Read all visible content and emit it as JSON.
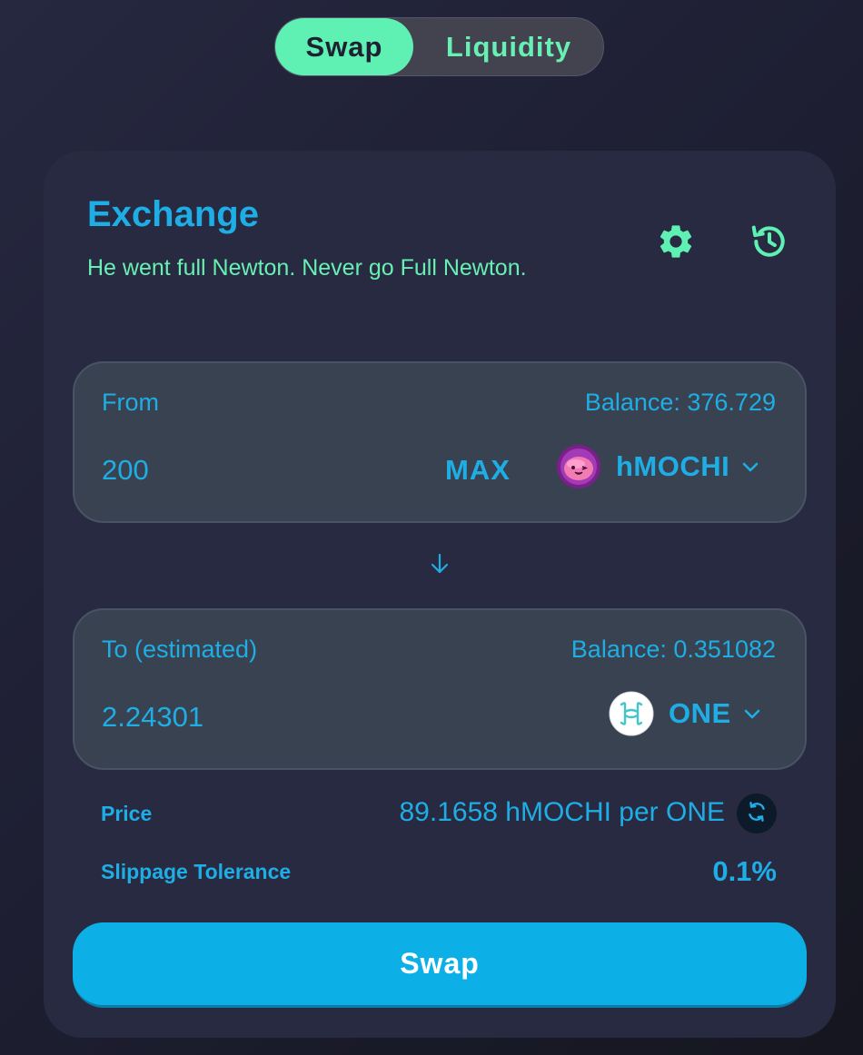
{
  "mode_toggle": {
    "swap_label": "Swap",
    "liquidity_label": "Liquidity",
    "active": "Swap"
  },
  "header": {
    "title": "Exchange",
    "subtitle": "He went full Newton. Never go Full Newton.",
    "settings_icon": "gear-icon",
    "history_icon": "history-icon"
  },
  "from": {
    "label": "From",
    "balance": "Balance: 376.729",
    "amount": "200",
    "max_label": "MAX",
    "token_symbol": "hMOCHI",
    "token_icon": "hmochi-token-icon"
  },
  "to": {
    "label": "To (estimated)",
    "balance": "Balance: 0.351082",
    "amount": "2.24301",
    "token_symbol": "ONE",
    "token_icon": "harmony-one-token-icon"
  },
  "details": {
    "price_label": "Price",
    "price_value": "89.1658 hMOCHI per ONE",
    "slippage_label": "Slippage Tolerance",
    "slippage_value": "0.1%"
  },
  "action": {
    "swap_button_label": "Swap"
  },
  "colors": {
    "accent_blue": "#1eaee5",
    "accent_green": "#5ff0b4",
    "card_bg": "#272a40",
    "panel_bg": "#394251",
    "button_bg": "#0db0e6"
  }
}
